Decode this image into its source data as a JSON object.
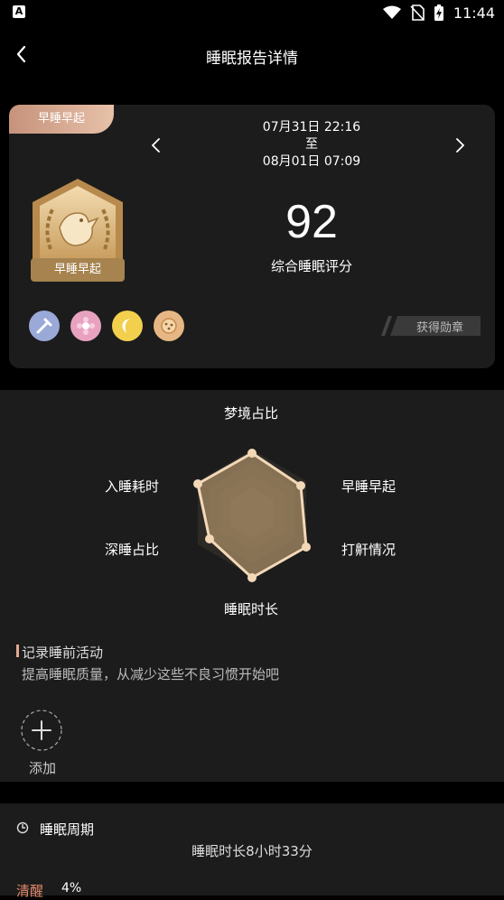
{
  "status": {
    "app_icon_letter": "A",
    "time": "11:44"
  },
  "header": {
    "title": "睡眠报告详情"
  },
  "report": {
    "badge_tag": "早睡早起",
    "date_start": "07月31日 22:16",
    "date_to": "至",
    "date_end": "08月01日 07:09",
    "medal_caption": "早睡早起",
    "score": "92",
    "score_label": "综合睡眠评分",
    "earned_label": "获得勋章",
    "mini_badges": [
      {
        "icon": "wrench-badge-icon",
        "color": "#9aa9d8"
      },
      {
        "icon": "flower-badge-icon",
        "color": "#e8a2c0"
      },
      {
        "icon": "moon-badge-icon",
        "color": "#f2d04e"
      },
      {
        "icon": "cookie-badge-icon",
        "color": "#e6b784"
      }
    ]
  },
  "radar": {
    "labels": {
      "top": "梦境占比",
      "upper_left": "入睡耗时",
      "upper_right": "早睡早起",
      "lower_left": "深睡占比",
      "lower_right": "打鼾情况",
      "bottom": "睡眠时长"
    }
  },
  "activities": {
    "title": "记录睡前活动",
    "subtitle": "提高睡眠质量，从减少这些不良习惯开始吧",
    "add_label": "添加"
  },
  "cycle": {
    "title": "睡眠周期",
    "duration": "睡眠时长8小时33分",
    "awake_label": "清醒",
    "awake_value": "4%"
  },
  "colors": {
    "accent": "#e0a890",
    "gold": "#a6834f",
    "card": "#1c1c1c"
  }
}
